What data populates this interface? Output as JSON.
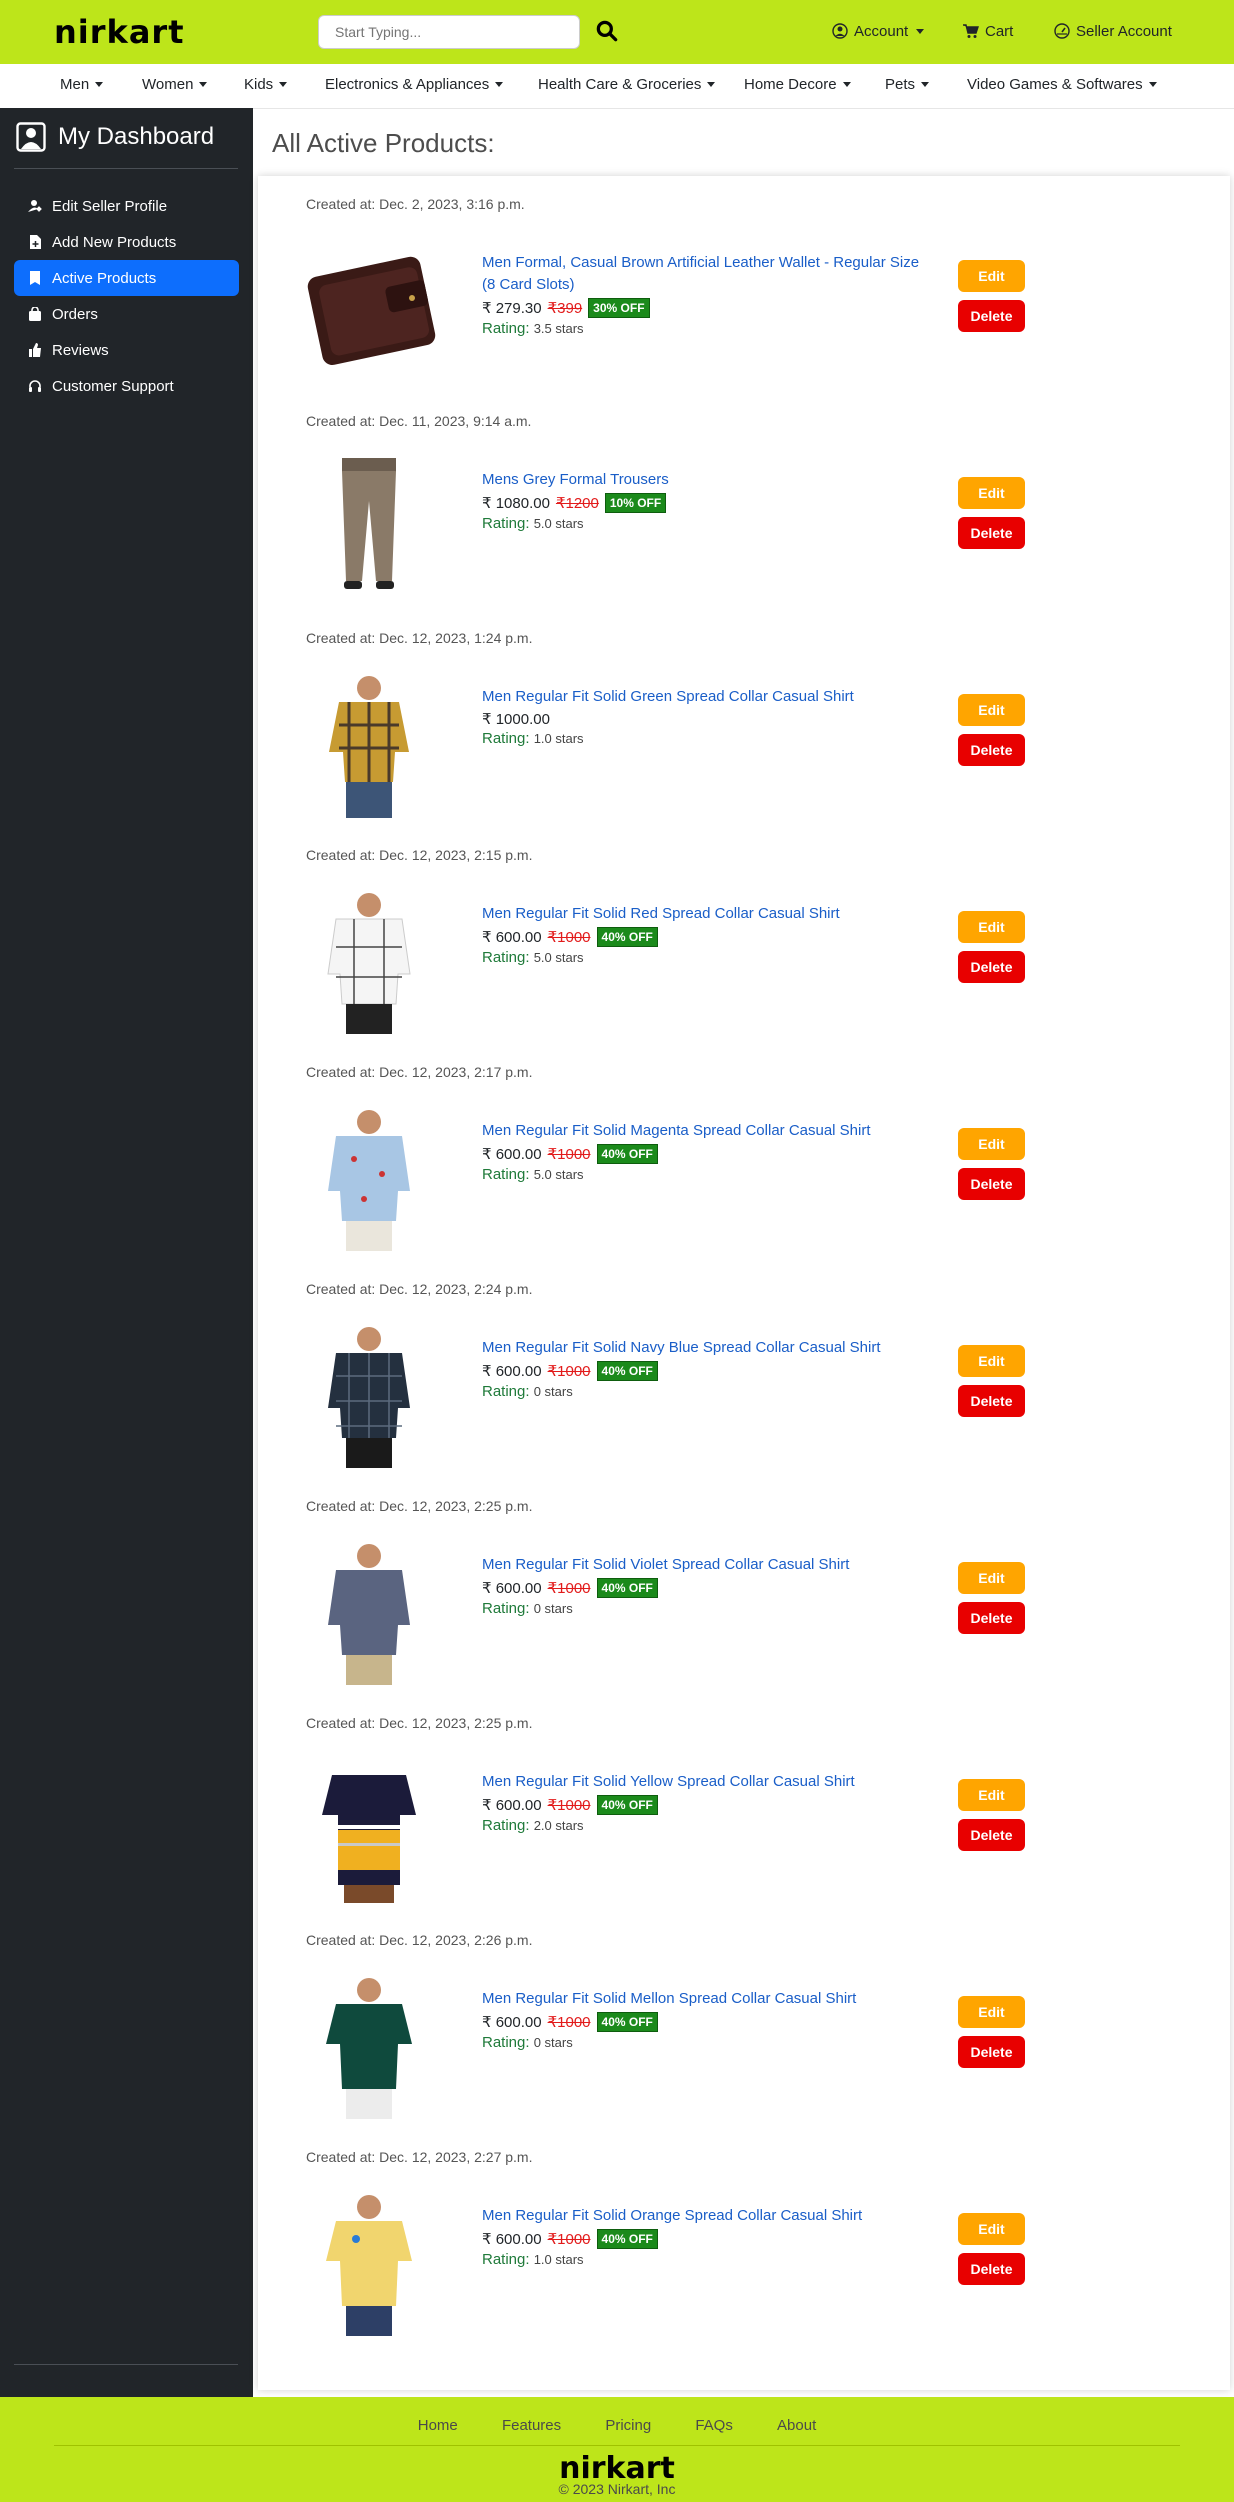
{
  "header": {
    "logo": "nirkart",
    "search_placeholder": "Start Typing...",
    "account": "Account",
    "cart": "Cart",
    "seller": "Seller Account"
  },
  "categories": [
    "Men",
    "Women",
    "Kids",
    "Electronics & Appliances",
    "Health Care & Groceries",
    "Home Decore",
    "Pets",
    "Video Games & Softwares"
  ],
  "sidebar": {
    "title": "My Dashboard",
    "items": [
      {
        "label": "Edit Seller Profile",
        "icon": "user-edit-icon"
      },
      {
        "label": "Add New Products",
        "icon": "file-add-icon"
      },
      {
        "label": "Active Products",
        "icon": "bookmark-icon"
      },
      {
        "label": "Orders",
        "icon": "bag-icon"
      },
      {
        "label": "Reviews",
        "icon": "thumbs-up-icon"
      },
      {
        "label": "Customer Support",
        "icon": "headset-icon"
      }
    ]
  },
  "main": {
    "title": "All Active Products:",
    "edit_label": "Edit",
    "delete_label": "Delete",
    "rating_label": "Rating:",
    "created_prefix": "Created at: "
  },
  "products": [
    {
      "created": "Dec. 2, 2023, 3:16 p.m.",
      "name": "Men Formal, Casual Brown Artificial Leather Wallet - Regular Size (8 Card Slots)",
      "price": "₹ 279.30",
      "old": "₹399",
      "off": "30% OFF",
      "rating": "3.5 stars",
      "thumb": "wallet"
    },
    {
      "created": "Dec. 11, 2023, 9:14 a.m.",
      "name": "Mens Grey Formal Trousers",
      "price": "₹ 1080.00",
      "old": "₹1200",
      "off": "10% OFF",
      "rating": "5.0 stars",
      "thumb": "trousers"
    },
    {
      "created": "Dec. 12, 2023, 1:24 p.m.",
      "name": "Men Regular Fit Solid Green Spread Collar Casual Shirt",
      "price": "₹ 1000.00",
      "old": "",
      "off": "",
      "rating": "1.0 stars",
      "thumb": "shirt-check-yellow"
    },
    {
      "created": "Dec. 12, 2023, 2:15 p.m.",
      "name": "Men Regular Fit Solid Red Spread Collar Casual Shirt",
      "price": "₹ 600.00",
      "old": "₹1000",
      "off": "40% OFF",
      "rating": "5.0 stars",
      "thumb": "shirt-white"
    },
    {
      "created": "Dec. 12, 2023, 2:17 p.m.",
      "name": "Men Regular Fit Solid Magenta Spread Collar Casual Shirt",
      "price": "₹ 600.00",
      "old": "₹1000",
      "off": "40% OFF",
      "rating": "5.0 stars",
      "thumb": "shirt-lightblue"
    },
    {
      "created": "Dec. 12, 2023, 2:24 p.m.",
      "name": "Men Regular Fit Solid Navy Blue Spread Collar Casual Shirt",
      "price": "₹ 600.00",
      "old": "₹1000",
      "off": "40% OFF",
      "rating": "0 stars",
      "thumb": "shirt-navy-check"
    },
    {
      "created": "Dec. 12, 2023, 2:25 p.m.",
      "name": "Men Regular Fit Solid Violet Spread Collar Casual Shirt",
      "price": "₹ 600.00",
      "old": "₹1000",
      "off": "40% OFF",
      "rating": "0 stars",
      "thumb": "shirt-violet"
    },
    {
      "created": "Dec. 12, 2023, 2:25 p.m.",
      "name": "Men Regular Fit Solid Yellow Spread Collar Casual Shirt",
      "price": "₹ 600.00",
      "old": "₹1000",
      "off": "40% OFF",
      "rating": "2.0 stars",
      "thumb": "tshirt-stripe"
    },
    {
      "created": "Dec. 12, 2023, 2:26 p.m.",
      "name": "Men Regular Fit Solid Mellon Spread Collar Casual Shirt",
      "price": "₹ 600.00",
      "old": "₹1000",
      "off": "40% OFF",
      "rating": "0 stars",
      "thumb": "shirt-green"
    },
    {
      "created": "Dec. 12, 2023, 2:27 p.m.",
      "name": "Men Regular Fit Solid Orange Spread Collar Casual Shirt",
      "price": "₹ 600.00",
      "old": "₹1000",
      "off": "40% OFF",
      "rating": "1.0 stars",
      "thumb": "polo-yellow"
    }
  ],
  "footer": {
    "links": [
      "Home",
      "Features",
      "Pricing",
      "FAQs",
      "About"
    ],
    "logo": "nirkart",
    "copyright": "© 2023 Nirkart, Inc"
  },
  "colors": {
    "brand": "#bde51a",
    "active": "#0d6efd",
    "edit": "#ffa500",
    "delete": "#e80000",
    "discount": "#1b8a1b"
  }
}
